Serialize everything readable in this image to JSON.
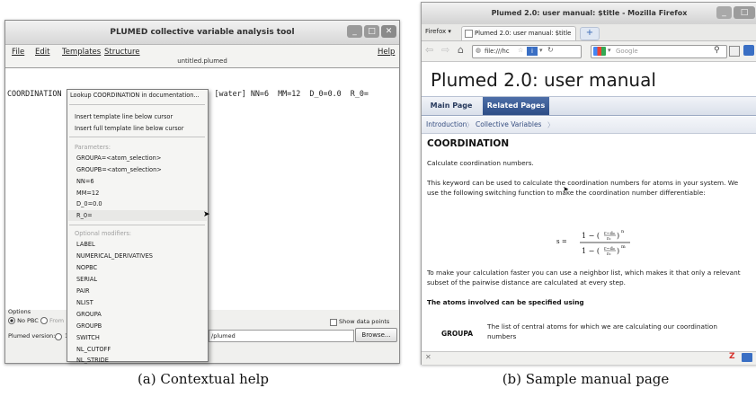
{
  "left_window": {
    "title": "PLUMED collective variable analysis tool",
    "menu": [
      "File",
      "Edit",
      "Templates",
      "Structure"
    ],
    "help": "Help",
    "filename": "untitled.plumed",
    "code_line": "COORDINATION GROUPA=[protein] GROUPB=[water] NN=6  MM=12  D_0=0.0  R_0=",
    "code_prefix": "COORDINATION",
    "code_suffix": "[water] NN=6  MM=12  D_0=0.0  R_0=",
    "popup": {
      "lookup": "Lookup COORDINATION in documentation...",
      "insert_template": "Insert template line below cursor",
      "insert_full": "Insert full template line below cursor",
      "params_header": "Parameters:",
      "params": [
        "GROUPA=<atom_selection>",
        "GROUPB=<atom_selection>",
        "NN=6",
        "MM=12",
        "D_0=0.0",
        "R_0="
      ],
      "modifiers_header": "Optional modifiers:",
      "modifiers": [
        "LABEL",
        "NUMERICAL_DERIVATIVES",
        "NOPBC",
        "SERIAL",
        "PAIR",
        "NLIST",
        "GROUPA",
        "GROUPB",
        "SWITCH",
        "NL_CUTOFF",
        "NL_STRIDE"
      ]
    },
    "options": {
      "label": "Options",
      "no_pbc": "No PBC",
      "from": "From",
      "show_data_points": "Show data points",
      "plumed_version": "Plumed version:",
      "version_value": "1",
      "path_value": "/plumed",
      "browse": "Browse..."
    }
  },
  "right_window": {
    "title": "Plumed 2.0: user manual: $title - Mozilla Firefox",
    "firefox_menu": "Firefox",
    "tab_label": "Plumed 2.0: user manual: $title",
    "url": "file:///hc",
    "search_placeholder": "Google",
    "page_title": "Plumed 2.0: user manual",
    "nav_tabs": [
      "Main Page",
      "Related Pages"
    ],
    "breadcrumbs": [
      "Introduction",
      "Collective Variables"
    ],
    "heading": "COORDINATION",
    "para1": "Calculate coordination numbers.",
    "para2": "This keyword can be used to calculate the coordination numbers for atoms in your system. We use the following switching function to make the coordination number differentiable:",
    "formula_lhs": "s =",
    "para3": "To make your calculation faster you can use a neighbor list, which makes it that only a relevant subset of the pairwise distance are calculated at every step.",
    "atoms_heading": "The atoms involved can be specified using",
    "groupa_label": "GROUPA",
    "groupa_desc": "The list of central atoms for which we are calculating our coordination numbers"
  },
  "captions": {
    "a": "(a) Contextual help",
    "b": "(b) Sample manual page"
  },
  "colors": {
    "active_tab": "#3b5b93",
    "close_button": "#d9534f",
    "link_blue": "#364e80"
  }
}
